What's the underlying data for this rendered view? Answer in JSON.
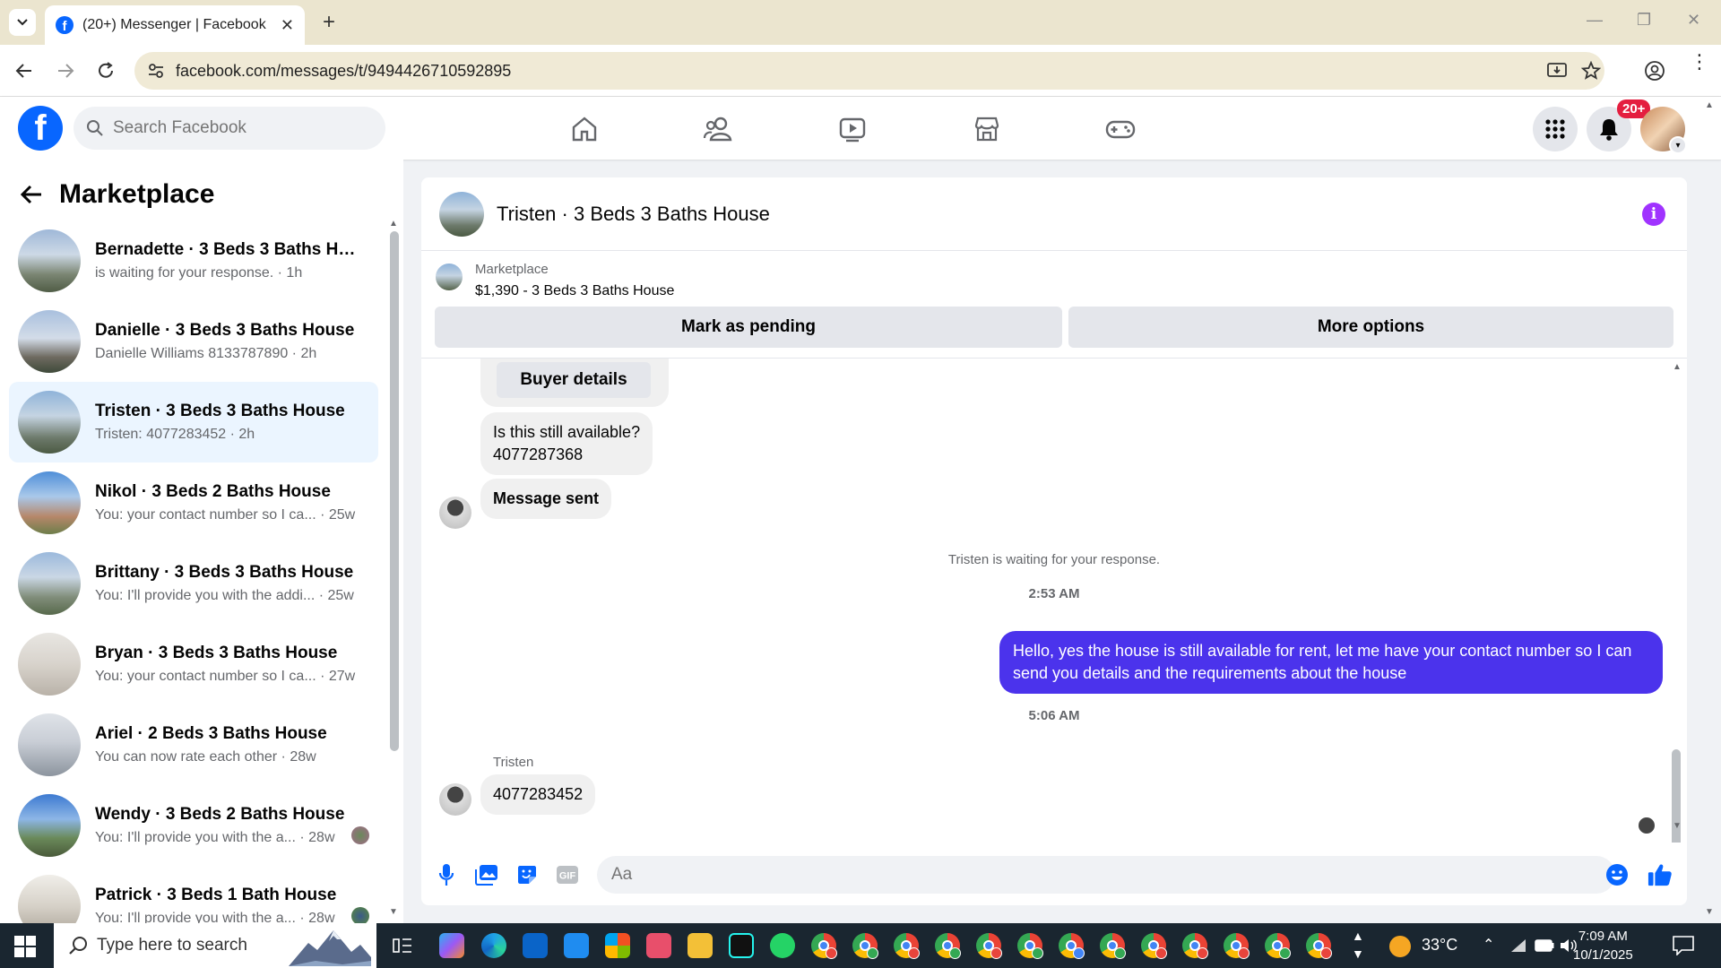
{
  "browser": {
    "tab_title": "(20+) Messenger | Facebook",
    "url": "facebook.com/messages/t/9494426710592895"
  },
  "fb": {
    "search_placeholder": "Search Facebook",
    "notification_badge": "20+"
  },
  "left": {
    "title": "Marketplace",
    "conversations": [
      {
        "name": "Bernadette · 3 Beds 3 Baths Hou...",
        "preview": "is waiting for your response. · 1h",
        "active": false
      },
      {
        "name": "Danielle · 3 Beds 3 Baths House",
        "preview": "Danielle Williams 8133787890 · 2h",
        "active": false
      },
      {
        "name": "Tristen · 3 Beds 3 Baths House",
        "preview": "Tristen: 4077283452 · 2h",
        "active": true
      },
      {
        "name": "Nikol · 3 Beds 2 Baths House",
        "preview": "You: your contact number so I ca... · 25w",
        "active": false
      },
      {
        "name": "Brittany · 3 Beds 3 Baths House",
        "preview": "You: I'll provide you with the addi... · 25w",
        "active": false
      },
      {
        "name": "Bryan · 3 Beds 3 Baths House",
        "preview": "You: your contact number so I ca... · 27w",
        "active": false
      },
      {
        "name": "Ariel · 2 Beds 3 Baths House",
        "preview": "You can now rate each other · 28w",
        "active": false
      },
      {
        "name": "Wendy · 3 Beds 2 Baths House",
        "preview": "You: I'll provide you with the a... · 28w",
        "active": false
      },
      {
        "name": "Patrick · 3 Beds 1 Bath House",
        "preview": "You: I'll provide you with the a... · 28w",
        "active": false
      }
    ]
  },
  "chat": {
    "title": "Tristen · 3 Beds 3 Baths House",
    "listing_label": "Marketplace",
    "listing_price": "$1,390 - 3 Beds 3 Baths House",
    "mark_pending": "Mark as pending",
    "more_options": "More options",
    "buyer_details": "Buyer details",
    "msg1_line1": "Is this still available?",
    "msg1_line2": "4077287368",
    "msg2": "Message sent",
    "system": "Tristen is waiting for your response.",
    "time1": "2:53 AM",
    "out_msg": "Hello, yes the house is still available for rent, let me have your contact number so I can send you details and the requirements about the house",
    "time2": "5:06 AM",
    "sender": "Tristen",
    "msg3": "4077283452",
    "composer_placeholder": "Aa"
  },
  "taskbar": {
    "search_placeholder": "Type here to search",
    "temp": "33°C",
    "time": "7:09 AM",
    "date": "10/1/2025"
  }
}
